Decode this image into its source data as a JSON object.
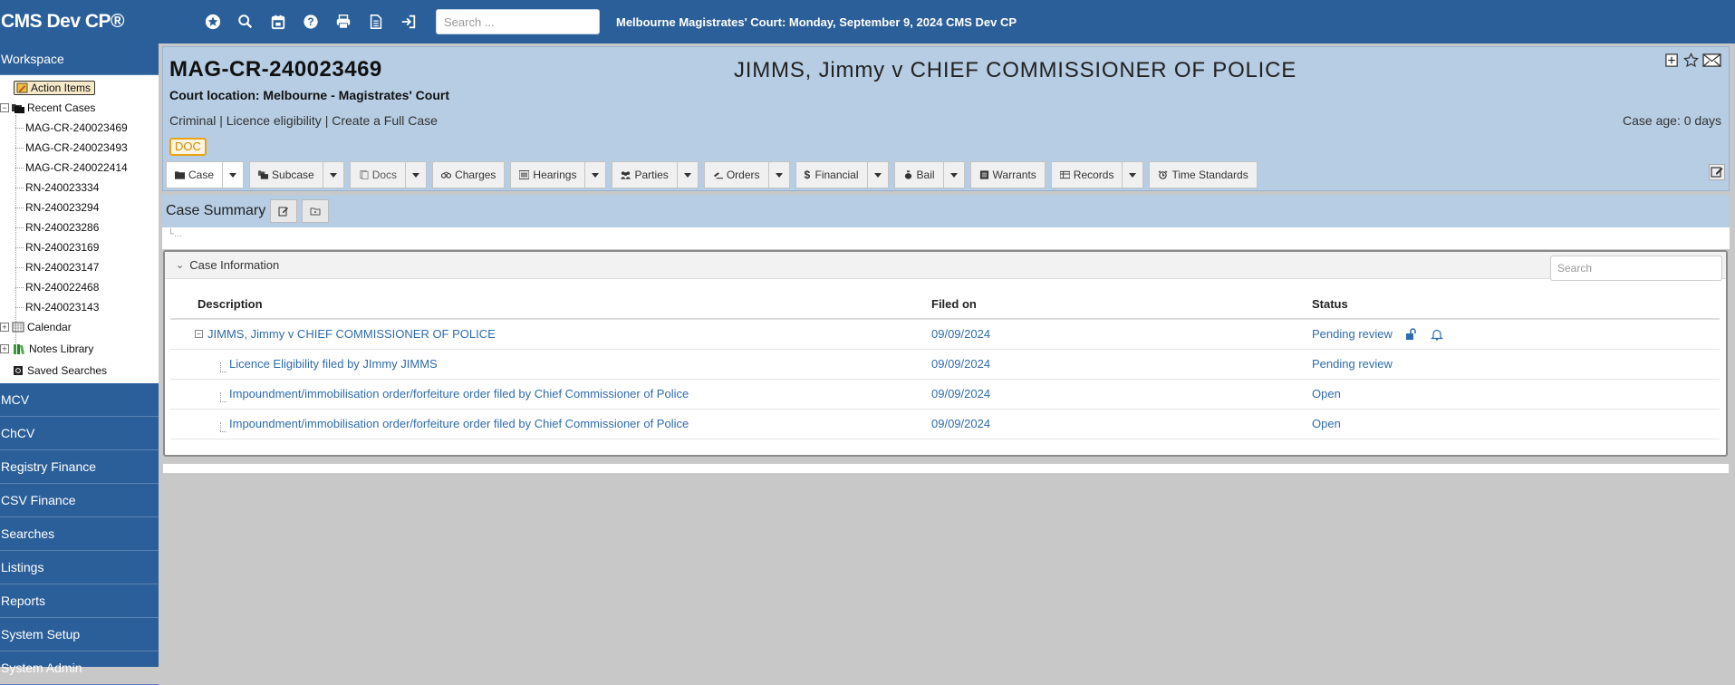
{
  "app": {
    "brand": "CMS Dev CP®",
    "search_placeholder": "Search ...",
    "top_info": "Melbourne Magistrates' Court: Monday, September 9, 2024 CMS Dev CP"
  },
  "toolbar_icons": [
    "star-icon",
    "search-icon",
    "calendar-icon",
    "help-icon",
    "print-icon",
    "document-icon",
    "logout-icon"
  ],
  "sidebar": {
    "workspace_label": "Workspace",
    "tree": {
      "action_items": "Action Items",
      "recent_cases": "Recent Cases",
      "cases": [
        "MAG-CR-240023469",
        "MAG-CR-240023493",
        "MAG-CR-240022414",
        "RN-240023334",
        "RN-240023294",
        "RN-240023286",
        "RN-240023169",
        "RN-240023147",
        "RN-240022468",
        "RN-240023143"
      ],
      "calendar": "Calendar",
      "notes_library": "Notes Library",
      "saved_searches": "Saved Searches"
    },
    "nav": [
      "MCV",
      "ChCV",
      "Registry Finance",
      "CSV Finance",
      "Searches",
      "Listings",
      "Reports",
      "System Setup",
      "System Admin"
    ]
  },
  "case": {
    "id": "MAG-CR-240023469",
    "court_location": "Court location: Melbourne - Magistrates' Court",
    "title": "JIMMS, Jimmy v CHIEF COMMISSIONER OF POLICE",
    "type_line": "Criminal | Licence eligibility | Create a Full Case",
    "age": "Case age: 0 days",
    "badge": "DOC"
  },
  "buttons": [
    {
      "label": "Case",
      "icon": "folder-icon",
      "dropdown": true
    },
    {
      "label": "Subcase",
      "icon": "folders-icon",
      "dropdown": true
    },
    {
      "label": "Docs",
      "icon": "docs-icon",
      "dropdown": true
    },
    {
      "label": "Charges",
      "icon": "handcuffs-icon",
      "dropdown": false
    },
    {
      "label": "Hearings",
      "icon": "list-icon",
      "dropdown": true
    },
    {
      "label": "Parties",
      "icon": "people-icon",
      "dropdown": true
    },
    {
      "label": "Orders",
      "icon": "gavel-icon",
      "dropdown": true
    },
    {
      "label": "Financial",
      "icon": "dollar-icon",
      "dropdown": true
    },
    {
      "label": "Bail",
      "icon": "moneybag-icon",
      "dropdown": true
    },
    {
      "label": "Warrants",
      "icon": "warrant-icon",
      "dropdown": false
    },
    {
      "label": "Records",
      "icon": "records-icon",
      "dropdown": true
    },
    {
      "label": "Time Standards",
      "icon": "alarm-icon",
      "dropdown": false
    }
  ],
  "summary": {
    "title": "Case Summary",
    "breadcrumb_stub": "└..."
  },
  "case_info": {
    "title": "Case Information",
    "search_placeholder": "Search",
    "columns": [
      "Description",
      "Filed on",
      "Status"
    ],
    "rows": [
      {
        "description": "JIMMS, Jimmy v CHIEF COMMISSIONER OF POLICE",
        "filed": "09/09/2024",
        "status": "Pending review"
      },
      {
        "description": "Licence Eligibility filed by JImmy JIMMS",
        "filed": "09/09/2024",
        "status": "Pending review"
      },
      {
        "description": "Impoundment/immobilisation order/forfeiture order filed by Chief Commissioner of Police",
        "filed": "09/09/2024",
        "status": "Open"
      },
      {
        "description": "Impoundment/immobilisation order/forfeiture order filed by Chief Commissioner of Police",
        "filed": "09/09/2024",
        "status": "Open"
      }
    ]
  },
  "colors": {
    "nav_blue": "#2b5f99",
    "header_light_blue": "#b6cde3",
    "link_blue": "#2e6cb0",
    "badge_orange": "#e8a317"
  }
}
